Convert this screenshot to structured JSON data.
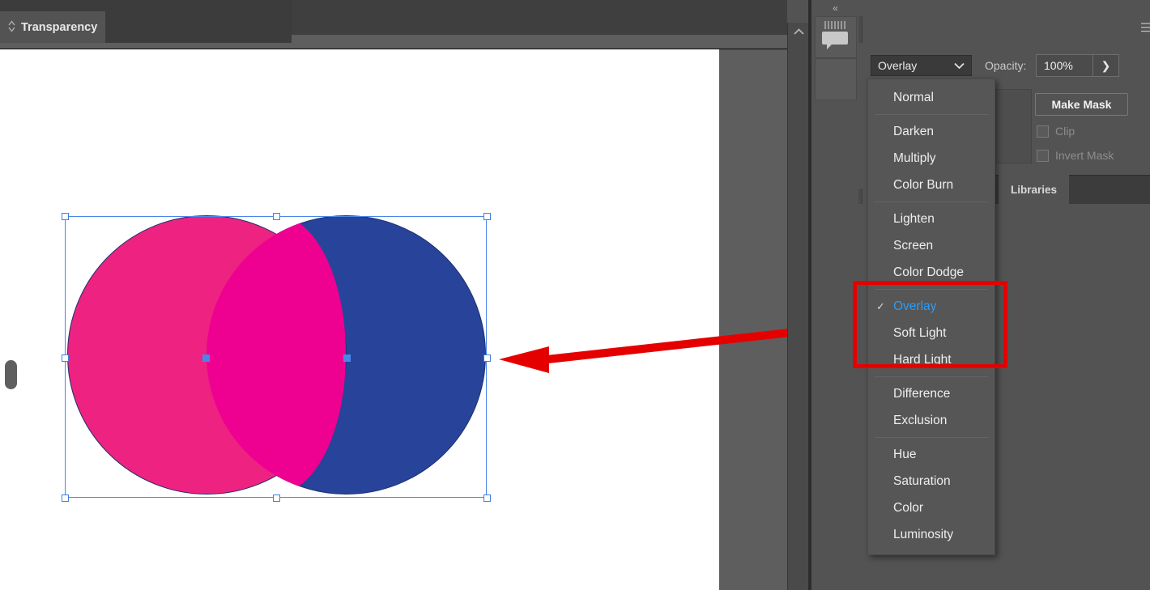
{
  "document": {
    "canvas_background": "#ffffff",
    "shapes": [
      {
        "name": "pink-circle",
        "fill": "#ED2281",
        "stroke": "#1e2f6e"
      },
      {
        "name": "blue-circle",
        "fill": "#27449A",
        "stroke": "#1e2f6e"
      },
      {
        "name": "overlap-region",
        "fill": "#EE0090"
      }
    ],
    "selection": {
      "handles_visible": true,
      "handle_color": "#4a86e8"
    }
  },
  "scrollbar": {
    "up_arrow": "chevron-up-icon"
  },
  "icon_rail": {
    "collapse_label": "«",
    "comment_icon": "comment-bubble-icon"
  },
  "panel": {
    "tab_label": "Transparency",
    "tab_chevron_icon": "double-chevron-icon",
    "menu_icon": "hamburger-menu-icon",
    "blend_mode": {
      "selected": "Overlay",
      "chevron_icon": "chevron-down-icon"
    },
    "opacity": {
      "label": "Opacity:",
      "value": "100%",
      "stepper_icon": "chevron-right-icon"
    },
    "make_mask_label": "Make Mask",
    "clip_label": "Clip",
    "invert_mask_label": "Invert Mask",
    "libraries_tab_label": "Libraries"
  },
  "blend_menu": {
    "checked_item": "Overlay",
    "check_glyph": "✓",
    "groups": [
      {
        "items": [
          "Normal"
        ]
      },
      {
        "items": [
          "Darken",
          "Multiply",
          "Color Burn"
        ]
      },
      {
        "items": [
          "Lighten",
          "Screen",
          "Color Dodge"
        ]
      },
      {
        "items": [
          "Overlay",
          "Soft Light",
          "Hard Light"
        ]
      },
      {
        "items": [
          "Difference",
          "Exclusion"
        ]
      },
      {
        "items": [
          "Hue",
          "Saturation",
          "Color",
          "Luminosity"
        ]
      }
    ]
  },
  "annotation": {
    "highlight_color": "#e50000",
    "arrow_color": "#e50000",
    "highlighted_items": [
      "Overlay",
      "Soft Light",
      "Hard Light"
    ]
  }
}
